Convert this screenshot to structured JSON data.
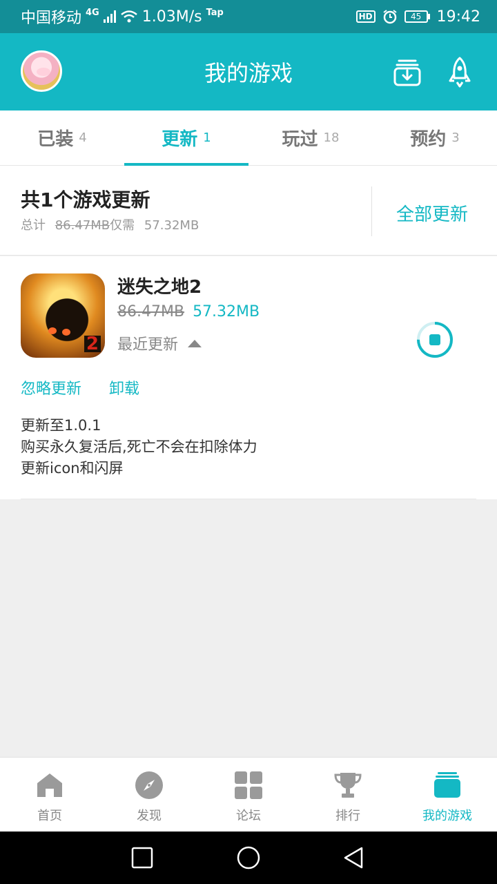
{
  "status_bar": {
    "carrier": "中国移动",
    "network_tag": "4G",
    "speed": "1.03M/s",
    "app_tag": "Tap",
    "hd_badge": "HD",
    "battery": "45",
    "time": "19:42"
  },
  "header": {
    "title": "我的游戏",
    "icons": [
      "avatar",
      "download-manager-icon",
      "rocket-icon"
    ]
  },
  "tabs": [
    {
      "label": "已装",
      "count": "4"
    },
    {
      "label": "更新",
      "count": "1",
      "active": true
    },
    {
      "label": "玩过",
      "count": "18"
    },
    {
      "label": "预约",
      "count": "3"
    }
  ],
  "summary": {
    "title": "共1个游戏更新",
    "total_label": "总计",
    "old_size": "86.47MB",
    "only_need": "仅需",
    "new_size": "57.32MB",
    "update_all": "全部更新"
  },
  "game": {
    "name": "迷失之地2",
    "icon_digit": "2",
    "old_size": "86.47MB",
    "new_size": "57.32MB",
    "recent_label": "最近更新",
    "ignore_label": "忽略更新",
    "uninstall_label": "卸载",
    "notes": [
      "更新至1.0.1",
      "购买永久复活后,死亡不会在扣除体力",
      "更新icon和闪屏"
    ],
    "download_progress": 0.75
  },
  "bottom_nav": [
    {
      "label": "首页",
      "icon": "home-icon"
    },
    {
      "label": "发现",
      "icon": "compass-icon"
    },
    {
      "label": "论坛",
      "icon": "grid-icon"
    },
    {
      "label": "排行",
      "icon": "trophy-icon"
    },
    {
      "label": "我的游戏",
      "icon": "my-games-icon",
      "active": true
    }
  ],
  "colors": {
    "accent": "#14b8c4",
    "status_bar": "#138e97"
  }
}
